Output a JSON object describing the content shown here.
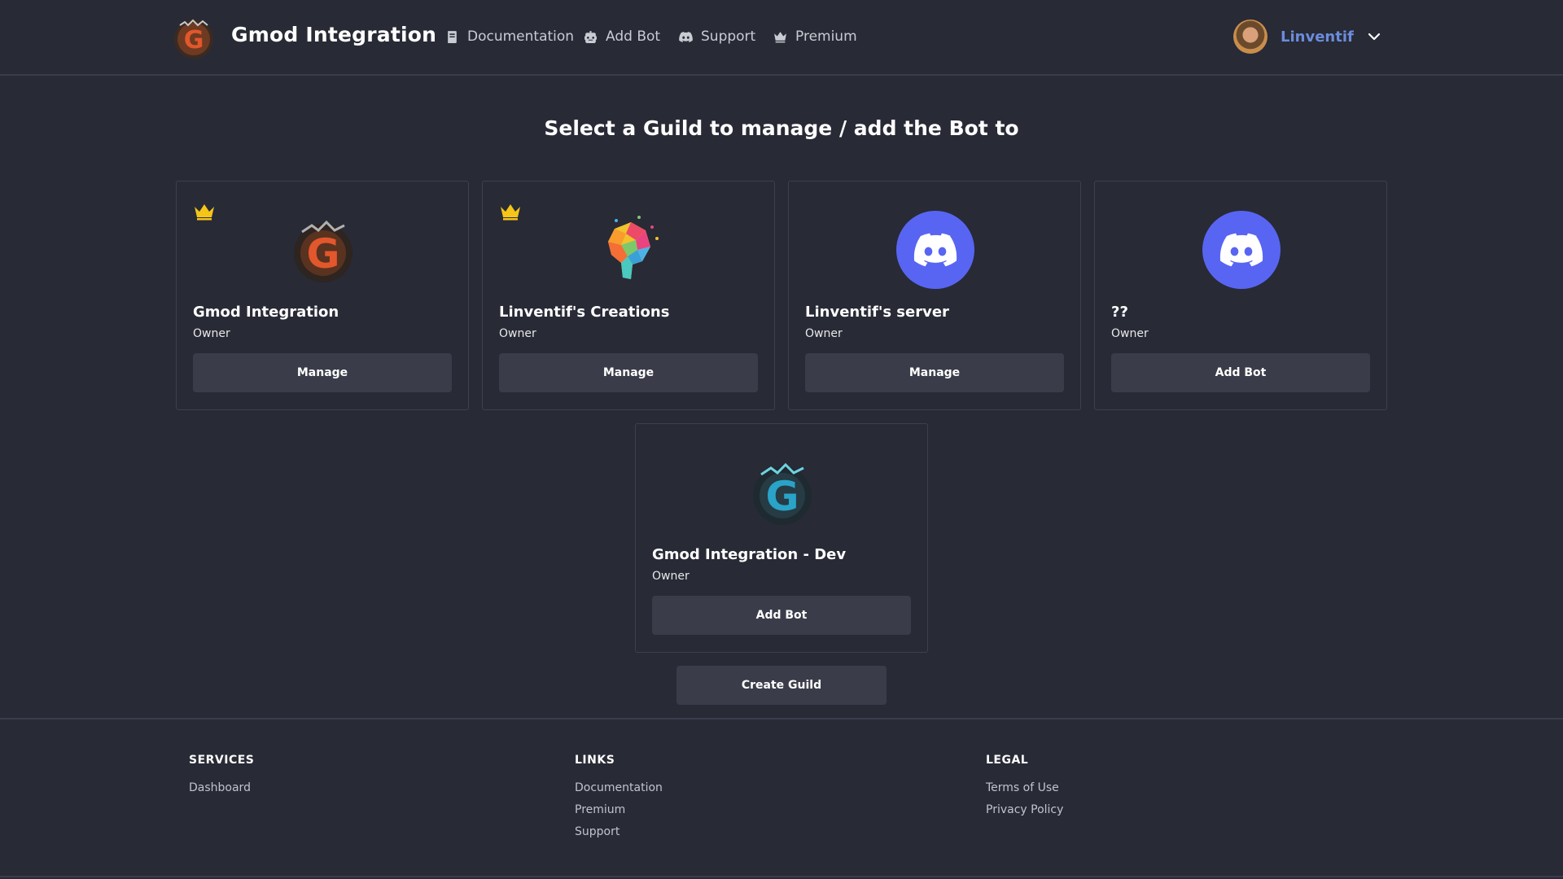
{
  "header": {
    "brand_name": "Gmod Integration",
    "nav": [
      {
        "label": "Documentation",
        "icon": "book-icon"
      },
      {
        "label": "Add Bot",
        "icon": "robot-icon"
      },
      {
        "label": "Support",
        "icon": "discord-icon"
      },
      {
        "label": "Premium",
        "icon": "crown-icon"
      }
    ],
    "user": {
      "name": "Linventif"
    }
  },
  "main": {
    "title": "Select a Guild to manage / add the Bot to",
    "guilds": [
      {
        "name": "Gmod Integration",
        "role": "Owner",
        "action": "Manage",
        "premium": true,
        "icon": "gmod-logo"
      },
      {
        "name": "Linventif's Creations",
        "role": "Owner",
        "action": "Manage",
        "premium": true,
        "icon": "brain-logo"
      },
      {
        "name": "Linventif's server",
        "role": "Owner",
        "action": "Manage",
        "premium": false,
        "icon": "discord-logo"
      },
      {
        "name": "??",
        "role": "Owner",
        "action": "Add Bot",
        "premium": false,
        "icon": "discord-logo"
      },
      {
        "name": "Gmod Integration - Dev",
        "role": "Owner",
        "action": "Add Bot",
        "premium": false,
        "icon": "gmod-dev-logo"
      }
    ],
    "create_guild_label": "Create Guild"
  },
  "footer": {
    "services": {
      "heading": "SERVICES",
      "links": [
        "Dashboard"
      ]
    },
    "links": {
      "heading": "LINKS",
      "links": [
        "Documentation",
        "Premium",
        "Support"
      ]
    },
    "legal": {
      "heading": "LEGAL",
      "links": [
        "Terms of Use",
        "Privacy Policy"
      ]
    }
  },
  "colors": {
    "background": "#282a36",
    "card_border": "#3d4050",
    "button": "#3a3d49",
    "accent_user": "#6b8cdb",
    "discord": "#5865f2",
    "crown": "#f5c518"
  }
}
